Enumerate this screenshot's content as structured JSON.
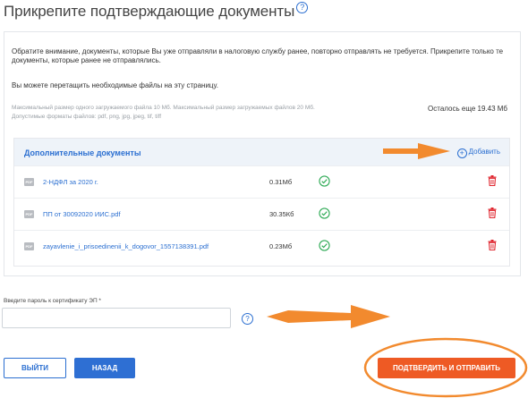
{
  "header": {
    "title": "Прикрепите подтверждающие документы",
    "help_glyph": "?"
  },
  "notice": {
    "text": "Обратите внимание, документы, которые Вы уже отправляли в налоговую службу ранее, повторно отправлять не требуется. Прикрепите только те документы, которые ранее не отправлялись.",
    "drag_hint": "Вы можете перетащить необходимые файлы на эту страницу."
  },
  "limits": {
    "max_sizes": "Максимальный размер одного загружаемого файла 10 Мб. Максимальный размер загружаемых файлов 20 Мб.",
    "formats": "Допустимые форматы файлов: pdf, png, jpg, jpeg, tif, tiff",
    "remaining": "Осталось еще 19.43 Мб"
  },
  "documents": {
    "title": "Дополнительные документы",
    "add_label": "Добавить",
    "add_glyph": "+",
    "items": [
      {
        "type": "PDF",
        "name": "2-НДФЛ за 2020 г.",
        "size": "0.31Мб"
      },
      {
        "type": "PDF",
        "name": "ПП от 30092020 ИИС.pdf",
        "size": "30.35Кб"
      },
      {
        "type": "PDF",
        "name": "zayavlenie_i_prisoedinenii_k_dogovor_1557138391.pdf",
        "size": "0.23Мб"
      }
    ]
  },
  "password": {
    "label": "Введите пароль к сертификату ЭП *",
    "value": "",
    "help_glyph": "?"
  },
  "buttons": {
    "exit": "ВЫЙТИ",
    "back": "НАЗАД",
    "submit": "ПОДТВЕРДИТЬ И ОТПРАВИТЬ"
  },
  "colors": {
    "accent": "#2b6fd1",
    "submit": "#ee5a24",
    "annotation": "#f28a2e",
    "success": "#2eaa55",
    "danger": "#e0262f"
  },
  "icons": {
    "add": "plus-circle-icon",
    "status": "check-circle-icon",
    "delete": "trash-icon",
    "file": "pdf-icon",
    "help": "question-circle-icon"
  }
}
